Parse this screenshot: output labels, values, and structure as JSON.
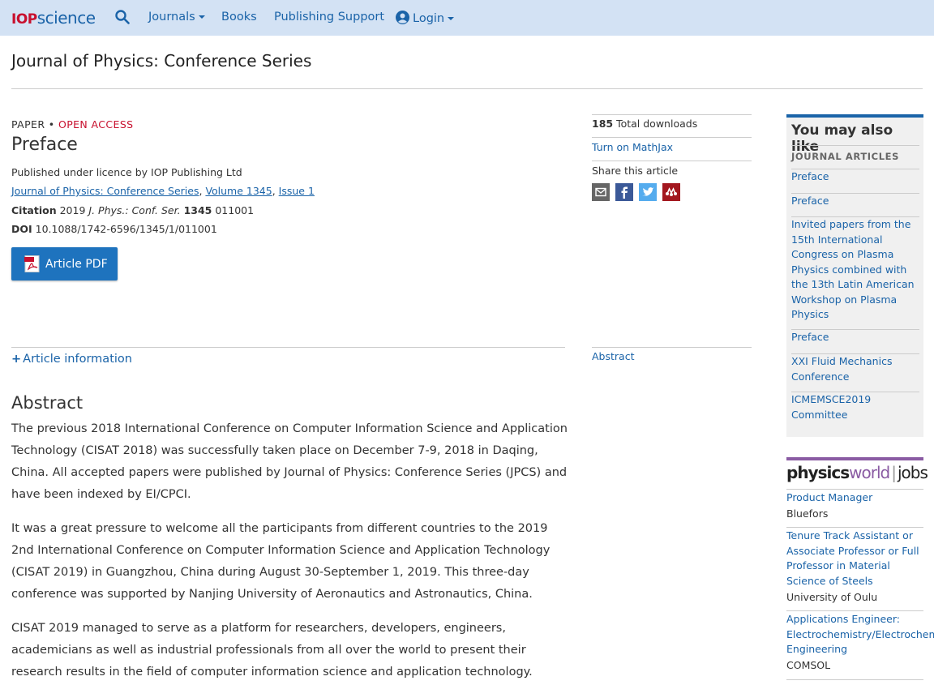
{
  "nav": {
    "logo_iop": "IOP",
    "logo_science": "science",
    "journals": "Journals",
    "books": "Books",
    "publishing_support": "Publishing Support",
    "login": "Login"
  },
  "journal_title": "Journal of Physics: Conference Series",
  "article": {
    "type": "PAPER",
    "access": "OPEN ACCESS",
    "separator": "•",
    "title": "Preface",
    "licence": "Published under licence by IOP Publishing Ltd",
    "breadcrumb": {
      "journal": "Journal of Physics: Conference Series",
      "volume": "Volume 1345",
      "issue": "Issue 1"
    },
    "citation_label": "Citation",
    "citation_year": "2019",
    "citation_journal": "J. Phys.: Conf. Ser.",
    "citation_volume": "1345",
    "citation_article": "011001",
    "doi_label": "DOI",
    "doi": "10.1088/1742-6596/1345/1/011001",
    "pdf_button": "Article PDF",
    "article_information": "Article information",
    "abstract_heading": "Abstract",
    "abstract_paragraphs": [
      "The previous 2018 International Conference on Computer Information Science and Application Technology (CISAT 2018) was successfully taken place on December 7-9, 2018 in Daqing, China. All accepted papers were published by Journal of Physics: Conference Series (JPCS) and have been indexed by EI/CPCI.",
      "It was a great pressure to welcome all the participants from different countries to the 2019 2nd International Conference on Computer Information Science and Application Technology (CISAT 2019) in Guangzhou, China during August 30-September 1, 2019. This three-day conference was supported by Nanjing University of Aeronautics and Astronautics, China.",
      "CISAT 2019 managed to serve as a platform for researchers, developers, engineers, academicians as well as industrial professionals from all over the world to present their research results in the field of computer information science and application technology. Professors from various prestigious"
    ]
  },
  "sidebar_mid": {
    "downloads_count": "185",
    "downloads_label": "Total downloads",
    "mathjax": "Turn on MathJax",
    "share_label": "Share this article",
    "abstract_link": "Abstract",
    "share_icons": [
      "email-icon",
      "facebook-icon",
      "twitter-icon",
      "mendeley-icon"
    ]
  },
  "you_may_also_like": {
    "title": "You may also like",
    "subtitle": "JOURNAL ARTICLES",
    "items": [
      "Preface",
      "Preface",
      "Invited papers from the 15th International Congress on Plasma Physics combined with the 13th Latin American Workshop on Plasma Physics",
      "Preface",
      "XXI Fluid Mechanics Conference",
      "ICMEMSCE2019 Committee"
    ]
  },
  "jobs": {
    "logo_physics": "physics",
    "logo_world": "world",
    "logo_sep": "|",
    "logo_jobs": "jobs",
    "items": [
      {
        "title": "Product Manager",
        "company": "Bluefors"
      },
      {
        "title": "Tenure Track Assistant or Associate Professor or Full Professor in Material Science of Steels",
        "company": "University of Oulu"
      },
      {
        "title": "Applications Engineer: Electrochemistry/Electrochemical Engineering",
        "company": "COMSOL"
      }
    ]
  },
  "colors": {
    "nav_bg": "#d3e2f4",
    "link": "#1a63a8",
    "open_access": "#c8102e",
    "pdf_button": "#1e73be",
    "physicsworld": "#8a5ba3"
  }
}
